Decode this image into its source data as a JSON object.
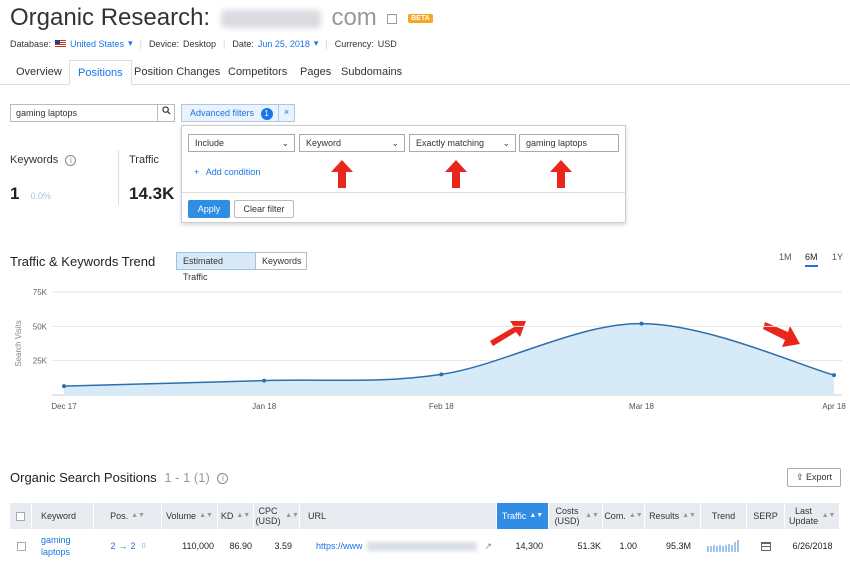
{
  "header": {
    "title": "Organic Research:",
    "domain_suffix": "com",
    "beta_badge": "BETA",
    "database_label": "Database:",
    "database_value": "United States",
    "device_label": "Device:",
    "device_value": "Desktop",
    "date_label": "Date:",
    "date_value": "Jun 25, 2018",
    "currency_label": "Currency:",
    "currency_value": "USD"
  },
  "tabs": [
    {
      "label": "Overview"
    },
    {
      "label": "Positions",
      "active": true
    },
    {
      "label": "Position Changes"
    },
    {
      "label": "Competitors"
    },
    {
      "label": "Pages"
    },
    {
      "label": "Subdomains"
    }
  ],
  "search": {
    "value": "gaming laptops"
  },
  "advanced_filters": {
    "label": "Advanced filters",
    "count": "1",
    "close": "×"
  },
  "filter_panel": {
    "include": "Include",
    "field": "Keyword",
    "match": "Exactly matching",
    "value": "gaming laptops",
    "add_condition": "Add condition",
    "apply": "Apply",
    "clear": "Clear filter"
  },
  "kpis": {
    "keywords_label": "Keywords",
    "keywords_value": "1",
    "keywords_change": "0.0%",
    "traffic_label": "Traffic",
    "traffic_value": "14.3K"
  },
  "trend": {
    "title": "Traffic & Keywords Trend",
    "toggle_traffic": "Estimated Traffic",
    "toggle_keywords": "Keywords",
    "ranges": [
      "1M",
      "6M",
      "1Y"
    ],
    "active_range": "6M"
  },
  "chart_data": {
    "type": "area",
    "ylabel": "Search Visits",
    "y_ticks": [
      "75K",
      "50K",
      "25K"
    ],
    "ylim": [
      0,
      75000
    ],
    "x_ticks": [
      "Dec 17",
      "Jan 18",
      "Feb 18",
      "Mar 18",
      "Apr 18"
    ],
    "series": [
      {
        "points": [
          {
            "x": "Dec 17",
            "y": 6500
          },
          {
            "x": "Jan 18",
            "y": 10500
          },
          {
            "x": "Feb 18",
            "y": 15000
          },
          {
            "x": "Mar 18",
            "y": 52000
          },
          {
            "x": "Apr 18",
            "y": 14500
          }
        ]
      }
    ],
    "colors": {
      "line": "#2c6fad",
      "fill": "#d7eaf8"
    },
    "grid": true
  },
  "positions": {
    "title": "Organic Search Positions",
    "range": "1 - 1 (1)",
    "export": "Export",
    "columns": [
      "Keyword",
      "Pos.",
      "Volume",
      "KD",
      "CPC (USD)",
      "URL",
      "Traffic",
      "Costs (USD)",
      "Com.",
      "Results",
      "Trend",
      "SERP",
      "Last Update"
    ],
    "rows": [
      {
        "keyword": "gaming laptops",
        "pos_from": "2",
        "pos_to": "2",
        "pos_extra": "0",
        "volume": "110,000",
        "kd": "86.90",
        "cpc": "3.59",
        "url": "https://www",
        "traffic": "14,300",
        "costs": "51.3K",
        "com": "1.00",
        "results": "95.3M",
        "last_update": "6/26/2018"
      }
    ]
  }
}
